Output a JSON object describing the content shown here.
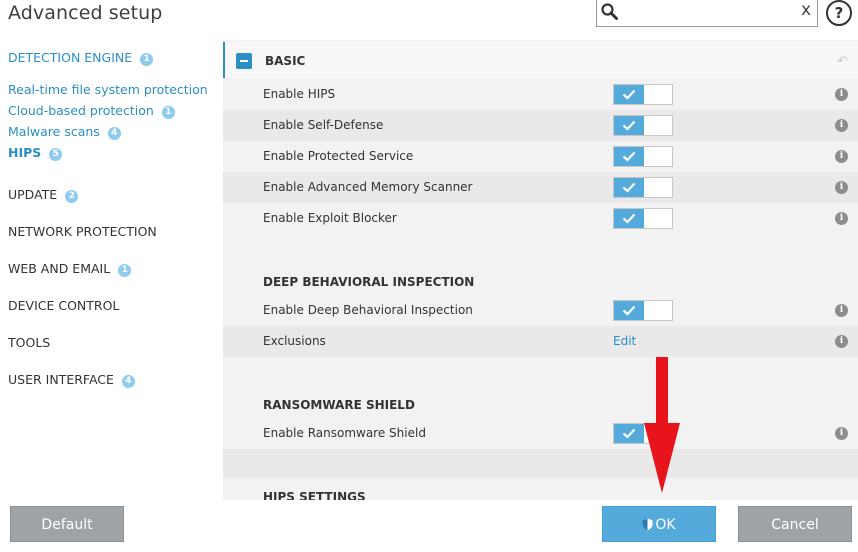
{
  "header": {
    "title": "Advanced setup",
    "search": {
      "value": "",
      "clear_label": "x"
    },
    "help_label": "?"
  },
  "sidebar": {
    "items": [
      {
        "label": "DETECTION ENGINE",
        "badge": "1"
      },
      {
        "label": "Real-time file system protection",
        "badge": ""
      },
      {
        "label": "Cloud-based protection",
        "badge": "1"
      },
      {
        "label": "Malware scans",
        "badge": "4"
      },
      {
        "label": "HIPS",
        "badge": "5"
      },
      {
        "label": "UPDATE",
        "badge": "2"
      },
      {
        "label": "NETWORK PROTECTION",
        "badge": ""
      },
      {
        "label": "WEB AND EMAIL",
        "badge": "1"
      },
      {
        "label": "DEVICE CONTROL",
        "badge": ""
      },
      {
        "label": "TOOLS",
        "badge": ""
      },
      {
        "label": "USER INTERFACE",
        "badge": "4"
      }
    ]
  },
  "main": {
    "basic": {
      "title": "BASIC",
      "rows": [
        {
          "label": "Enable HIPS",
          "enabled": true
        },
        {
          "label": "Enable Self-Defense",
          "enabled": true
        },
        {
          "label": "Enable Protected Service",
          "enabled": true
        },
        {
          "label": "Enable Advanced Memory Scanner",
          "enabled": true
        },
        {
          "label": "Enable Exploit Blocker",
          "enabled": true
        }
      ]
    },
    "deep": {
      "title": "DEEP BEHAVIORAL INSPECTION",
      "rows": [
        {
          "label": "Enable Deep Behavioral Inspection",
          "enabled": true
        },
        {
          "label": "Exclusions",
          "link": "Edit"
        }
      ]
    },
    "ransomware": {
      "title": "RANSOMWARE SHIELD",
      "rows": [
        {
          "label": "Enable Ransomware Shield",
          "enabled": true
        }
      ]
    },
    "hips_settings": {
      "title": "HIPS SETTINGS"
    },
    "info_label": "i"
  },
  "footer": {
    "default_label": "Default",
    "ok_label": "OK",
    "cancel_label": "Cancel"
  },
  "colors": {
    "accent": "#2b8fc6",
    "toggle_on": "#55aadc",
    "button_gray": "#9ea3a7",
    "arrow": "#e8141b"
  }
}
